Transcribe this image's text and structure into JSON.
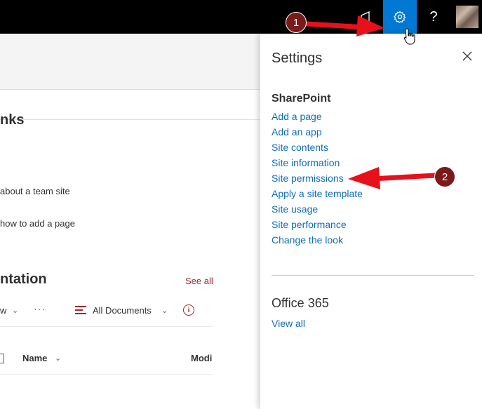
{
  "topbar": {
    "icons": [
      "megaphone-icon",
      "gear-icon",
      "help-icon",
      "avatar"
    ],
    "help_label": "?",
    "gear_color": "#0078d4"
  },
  "left": {
    "links_title": "nks",
    "link1": "about a team site",
    "link2": "how to add a page",
    "doc_title": "ntation",
    "see_all": "See all",
    "view_label": "w",
    "all_documents": "All Documents",
    "col_name": "Name",
    "col_modified": "Modi"
  },
  "settings": {
    "title": "Settings",
    "sharepoint_title": "SharePoint",
    "items": [
      "Add a page",
      "Add an app",
      "Site contents",
      "Site information",
      "Site permissions",
      "Apply a site template",
      "Site usage",
      "Site performance",
      "Change the look"
    ],
    "office_title": "Office 365",
    "view_all": "View all",
    "link_color": "#0f6cbd"
  },
  "annotations": {
    "callout1": "1",
    "callout2": "2",
    "arrow_color": "#e8101a"
  }
}
